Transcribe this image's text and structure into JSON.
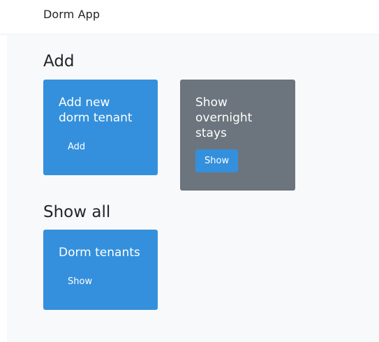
{
  "navbar": {
    "brand": "Dorm App"
  },
  "sections": {
    "add": {
      "title": "Add"
    },
    "show_all": {
      "title": "Show all"
    }
  },
  "cards": {
    "add_tenant": {
      "title": "Add new dorm tenant",
      "button": "Add"
    },
    "overnight": {
      "title": "Show overnight stays",
      "button": "Show"
    },
    "tenants": {
      "title": "Dorm tenants",
      "button": "Show"
    }
  },
  "colors": {
    "primary": "#3490dc",
    "secondary": "#6c757d",
    "background": "#f8f9fa"
  }
}
